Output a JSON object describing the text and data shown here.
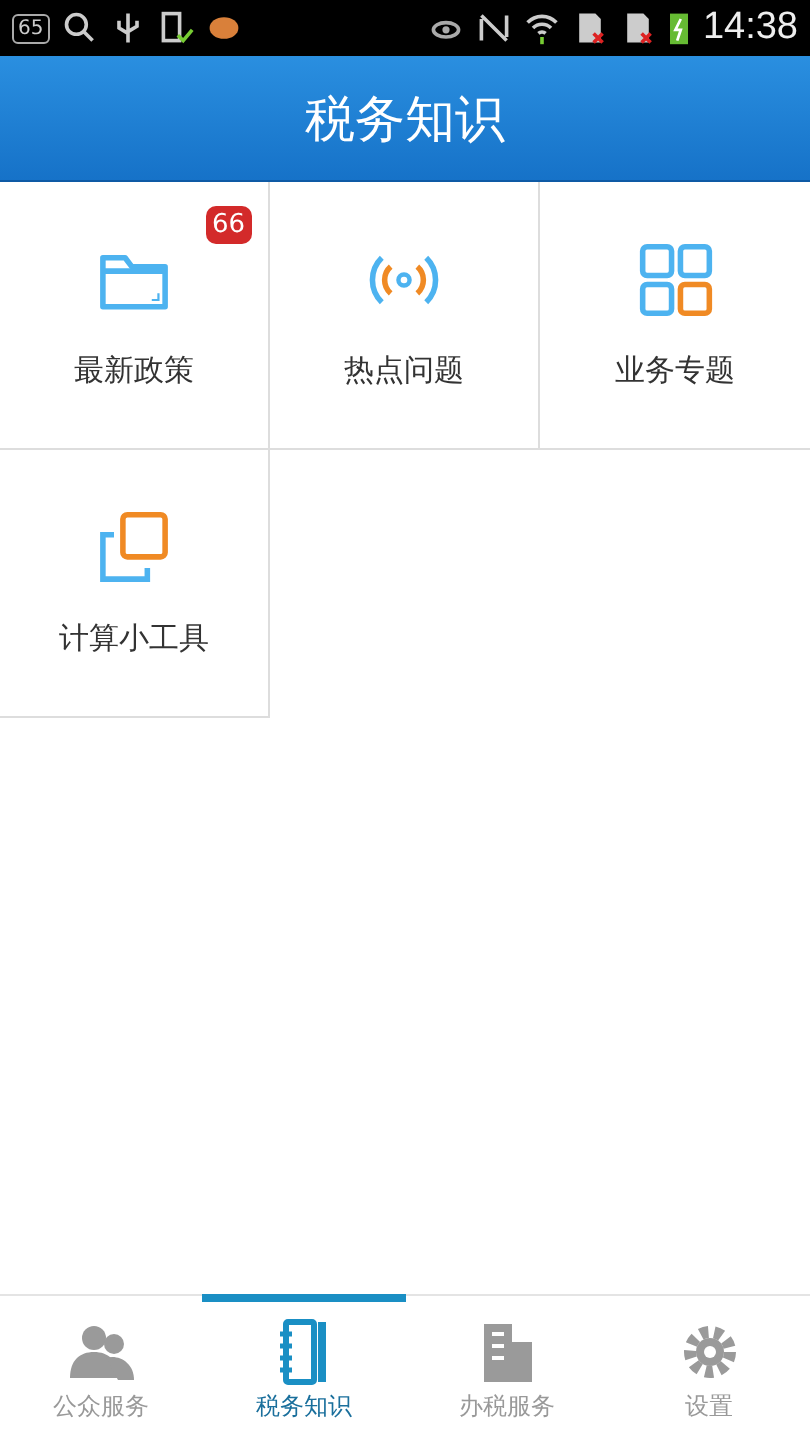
{
  "status_bar": {
    "notification_count": "65",
    "time": "14:38"
  },
  "header": {
    "title": "税务知识"
  },
  "grid": [
    {
      "label": "最新政策",
      "badge": "66"
    },
    {
      "label": "热点问题"
    },
    {
      "label": "业务专题"
    },
    {
      "label": "计算小工具"
    }
  ],
  "tabs": [
    {
      "label": "公众服务",
      "selected": false
    },
    {
      "label": "税务知识",
      "selected": true
    },
    {
      "label": "办税服务",
      "selected": false
    },
    {
      "label": "设置",
      "selected": false
    }
  ]
}
